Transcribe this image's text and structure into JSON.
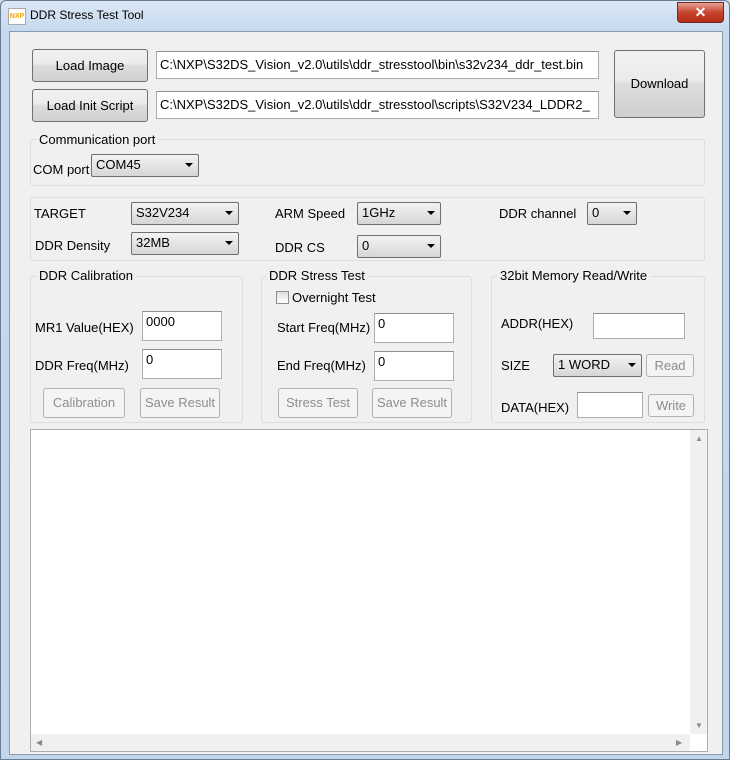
{
  "window": {
    "title": "DDR Stress Test Tool",
    "icon_text": "NXP",
    "close_symbol": "✕"
  },
  "files": {
    "load_image_label": "Load Image",
    "image_path": "C:\\NXP\\S32DS_Vision_v2.0\\utils\\ddr_stresstool\\bin\\s32v234_ddr_test.bin",
    "load_script_label": "Load Init Script",
    "script_path": "C:\\NXP\\S32DS_Vision_v2.0\\utils\\ddr_stresstool\\scripts\\S32V234_LDDR2_",
    "download_label": "Download"
  },
  "comm": {
    "group_title": "Communication port",
    "com_label": "COM port",
    "com_value": "COM45"
  },
  "config": {
    "target_label": "TARGET",
    "target_value": "S32V234",
    "arm_speed_label": "ARM Speed",
    "arm_speed_value": "1GHz",
    "ddr_channel_label": "DDR channel",
    "ddr_channel_value": "0",
    "ddr_density_label": "DDR Density",
    "ddr_density_value": "32MB",
    "ddr_cs_label": "DDR CS",
    "ddr_cs_value": "0"
  },
  "calibration": {
    "group_title": "DDR Calibration",
    "mr1_label": "MR1 Value(HEX)",
    "mr1_value": "0000",
    "freq_label": "DDR Freq(MHz)",
    "freq_value": "0",
    "calibration_button": "Calibration",
    "save_button": "Save Result"
  },
  "stress": {
    "group_title": "DDR Stress Test",
    "overnight_label": "Overnight Test",
    "start_label": "Start Freq(MHz)",
    "start_value": "0",
    "end_label": "End Freq(MHz)",
    "end_value": "0",
    "stress_button": "Stress Test",
    "save_button": "Save Result"
  },
  "memory": {
    "group_title": "32bit Memory Read/Write",
    "addr_label": "ADDR(HEX)",
    "addr_value": "",
    "size_label": "SIZE",
    "size_value": "1 WORD",
    "read_button": "Read",
    "data_label": "DATA(HEX)",
    "data_value": "",
    "write_button": "Write"
  },
  "log": {
    "text": ""
  }
}
